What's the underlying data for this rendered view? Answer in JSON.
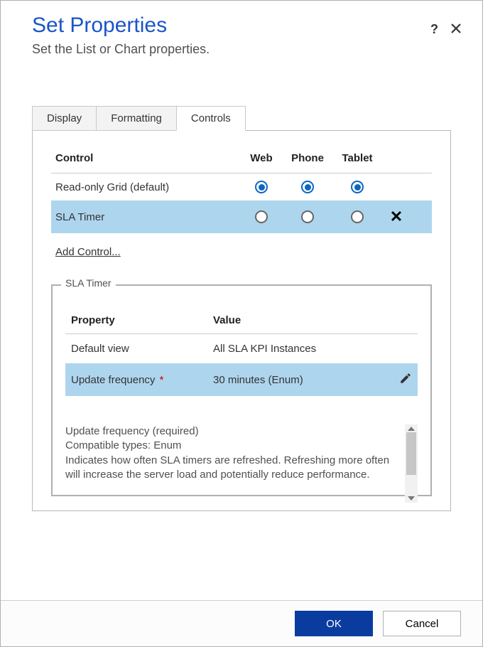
{
  "header": {
    "title": "Set Properties",
    "subtitle": "Set the List or Chart properties.",
    "help_symbol": "?"
  },
  "tabs": {
    "display": "Display",
    "formatting": "Formatting",
    "controls": "Controls"
  },
  "control_table": {
    "header_control": "Control",
    "header_web": "Web",
    "header_phone": "Phone",
    "header_tablet": "Tablet",
    "rows": [
      {
        "name": "Read-only Grid (default)",
        "web": true,
        "phone": true,
        "tablet": true
      },
      {
        "name": "SLA Timer",
        "web": false,
        "phone": false,
        "tablet": false
      }
    ],
    "add_control": "Add Control..."
  },
  "fieldset": {
    "legend": "SLA Timer",
    "prop_header_name": "Property",
    "prop_header_value": "Value",
    "rows": [
      {
        "name": "Default view",
        "value": "All SLA KPI Instances",
        "required": false
      },
      {
        "name": "Update frequency",
        "value": "30 minutes (Enum)",
        "required": true
      }
    ],
    "description": {
      "line1": "Update frequency (required)",
      "line2": "Compatible types: Enum",
      "body": "Indicates how often SLA timers are refreshed. Refreshing more often will increase the server load and potentially reduce performance."
    }
  },
  "footer": {
    "ok": "OK",
    "cancel": "Cancel"
  }
}
